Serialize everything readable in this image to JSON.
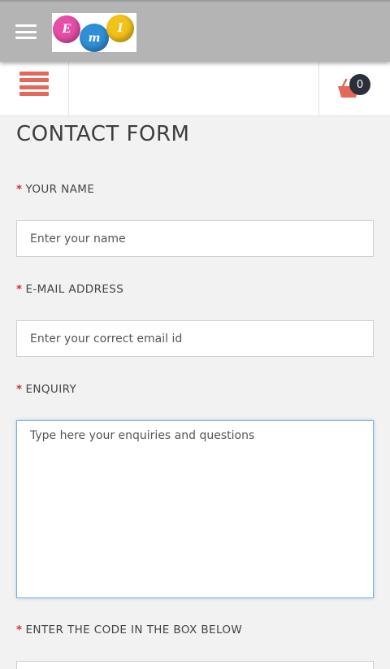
{
  "header": {
    "menu_icon": "hamburger-icon",
    "logo_letters": [
      "E",
      "m",
      "I"
    ],
    "logo_colors": [
      "#e64ea8",
      "#2f8fd6",
      "#f2c21a"
    ]
  },
  "subbar": {
    "menu_icon": "menu-list-icon",
    "cart_icon": "basket-icon",
    "cart_count": "0",
    "accent_color": "#e4685a"
  },
  "form": {
    "title": "CONTACT FORM",
    "required_marker": "*",
    "name": {
      "label": "YOUR NAME",
      "placeholder": "Enter your name",
      "value": ""
    },
    "email": {
      "label": "E-MAIL ADDRESS",
      "placeholder": "Enter your correct email id",
      "value": ""
    },
    "enquiry": {
      "label": "ENQUIRY",
      "placeholder": "Type here your enquiries and questions",
      "value": ""
    },
    "code": {
      "label": "ENTER THE CODE IN THE BOX BELOW"
    }
  }
}
